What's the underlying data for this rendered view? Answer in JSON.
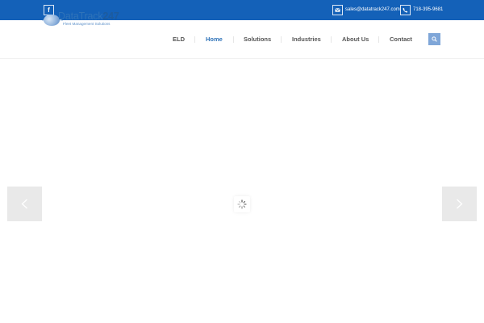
{
  "topbar": {
    "facebook_glyph": "f",
    "email": "sales@datatrack247.com",
    "phone": "718-395-9681",
    "bg_color": "#1461b8"
  },
  "logo": {
    "name_part1": "DataTrack",
    "name_part2": "247",
    "tagline": "Fleet Management Solutions"
  },
  "nav": {
    "items": [
      "ELD",
      "Home",
      "Solutions",
      "Industries",
      "About Us",
      "Contact"
    ],
    "active": "Home"
  },
  "icons": {
    "facebook": "facebook-icon",
    "mail": "mail-icon",
    "phone": "phone-icon",
    "search": "search-icon",
    "prev": "chevron-left-icon",
    "next": "chevron-right-icon",
    "loader": "loading-spinner-icon"
  },
  "colors": {
    "accent": "#2f73b9",
    "search_button": "#7fa6d8"
  }
}
